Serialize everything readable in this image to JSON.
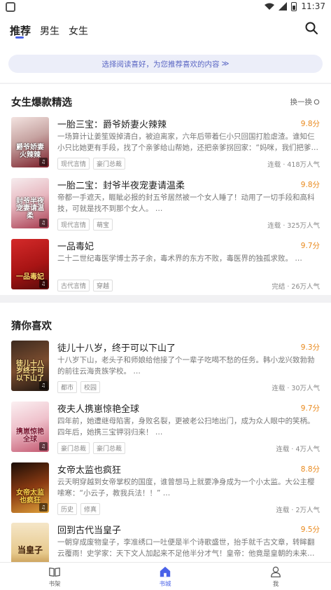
{
  "status_bar": {
    "time": "11:37"
  },
  "top_nav": {
    "tabs": [
      {
        "label": "推荐"
      },
      {
        "label": "男生"
      },
      {
        "label": "女生"
      }
    ]
  },
  "banner": {
    "text": "选择阅读喜好，为您推荐喜欢的内容",
    "arrow": "≫"
  },
  "section1": {
    "title": "女生爆款精选",
    "swap_label": "换一换",
    "books": [
      {
        "title": "一胎三宝：爵爷娇妻火辣辣",
        "score": "9.8分",
        "desc": "一场算计让姜笙毁掉清白，被迫离家，六年后带着仨小只回国打脸虐渣。谁知仨小只比她更有手段，找了个亲爹给山帮她，还把亲爹拐回家：“妈咪，我们把爹…",
        "tags": [
          "现代言情",
          "豪门总裁"
        ],
        "meta": "连载 · 418万人气",
        "cover_text": "爵爷娇妻火辣辣"
      },
      {
        "title": "一胎二宝：封爷半夜宠妻请温柔",
        "score": "9.8分",
        "desc": "帝都一手遮天，睚眦必报的封五爷居然被一个女人睡了！动用了一切手段和高科技，可就是找不到那个女人。 …",
        "tags": [
          "现代言情",
          "萌宝"
        ],
        "meta": "连载 · 325万人气",
        "cover_text": "封爷半夜宠妻请温柔"
      },
      {
        "title": "一品毒妃",
        "score": "9.7分",
        "desc": "二十二世纪毒医学博士苏子余，毒术界的东方不败，毒医界的独孤求败。 …",
        "tags": [
          "古代言情",
          "穿越"
        ],
        "meta": "完结 · 26万人气",
        "cover_text": "一品毒妃"
      }
    ]
  },
  "section2": {
    "title": "猜你喜欢",
    "books": [
      {
        "title": "徒儿十八岁，终于可以下山了",
        "score": "9.3分",
        "desc": "十八岁下山，老头子和师娘给他接了个一辈子吃喝不愁的任务。韩小龙兴致勃勃的前往云海贵族学校。 …",
        "tags": [
          "都市",
          "校园"
        ],
        "meta": "连载 · 30万人气",
        "cover_text": "徒儿十八岁终于可以下山了"
      },
      {
        "title": "夜夫人携崽惊艳全球",
        "score": "9.7分",
        "desc": "四年前，她遭继母陷害，身败名裂，更被老公扫地出门，成为众人眼中的笑柄。四年后，她携三宝钾羽归来！ …",
        "tags": [
          "豪门总裁",
          "豪门总裁"
        ],
        "meta": "连载 · 4万人气",
        "cover_text": "携崽惊艳全球"
      },
      {
        "title": "女帝太监也疯狂",
        "score": "8.8分",
        "desc": "云天明穿越到女帝掌权的国度，谁曾想马上就要净身成为一个小太监。大公主樱嗦寒：“小云子，教我兵法！！” …",
        "tags": [
          "历史",
          "修真"
        ],
        "meta": "连载 · 2万人气",
        "cover_text": "女帝太监也疯狂"
      },
      {
        "title": "回到古代当皇子",
        "score": "9.5分",
        "desc": "一朝穿成废物皇子，李准绣口一吐便是半个诗歌盛世，抬手就千古文章，转眸翻云覆雨！史学家：天下文人加起来不足他半分才气！皇帝：他竟是皇朝的未来…",
        "tags": [],
        "meta": "",
        "cover_text": "当皇子"
      }
    ]
  },
  "bottom_nav": {
    "items": [
      {
        "label": "书架"
      },
      {
        "label": "书城"
      },
      {
        "label": "我"
      }
    ]
  },
  "colors": {
    "accent": "#4a62e8",
    "score": "#e9891c"
  }
}
